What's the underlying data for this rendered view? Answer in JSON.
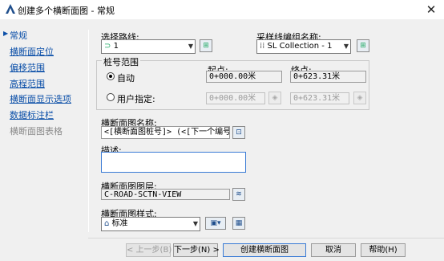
{
  "window": {
    "title": "创建多个横断面图 - 常规"
  },
  "nav": {
    "items": [
      {
        "label": "常规"
      },
      {
        "label": "横断面定位"
      },
      {
        "label": "偏移范围"
      },
      {
        "label": "高程范围"
      },
      {
        "label": "横断面显示选项"
      },
      {
        "label": "数据标注栏"
      },
      {
        "label": "横断面图表格"
      }
    ]
  },
  "alignment": {
    "label": "选择路线:",
    "value": "1"
  },
  "sample_line_group": {
    "label": "采样线编组名称:",
    "value": "SL Collection - 1"
  },
  "station_range": {
    "title": "桩号范围",
    "start_label": "起点:",
    "end_label": "终点:",
    "auto_label": "自动",
    "auto_start": "0+000.00米",
    "auto_end": "0+623.31米",
    "user_label": "用户指定:",
    "user_start": "0+000.00米",
    "user_end": "0+623.31米"
  },
  "view_name": {
    "label": "横断面图名称:",
    "value": "<[横断面图桩号]> (<[下一个编号(CP)]>)"
  },
  "description": {
    "label": "描述:",
    "value": ""
  },
  "view_layer": {
    "label": "横断面图图层:",
    "value": "C-ROAD-SCTN-VIEW"
  },
  "view_style": {
    "label": "横断面图样式:",
    "value": "标准"
  },
  "buttons": {
    "back": "< 上一步(B)",
    "next": "下一步(N) >",
    "create": "创建横断面图",
    "cancel": "取消",
    "help": "帮助(H)"
  },
  "colors": {
    "link": "#0b4fa8",
    "focus": "#3a7bd5"
  }
}
